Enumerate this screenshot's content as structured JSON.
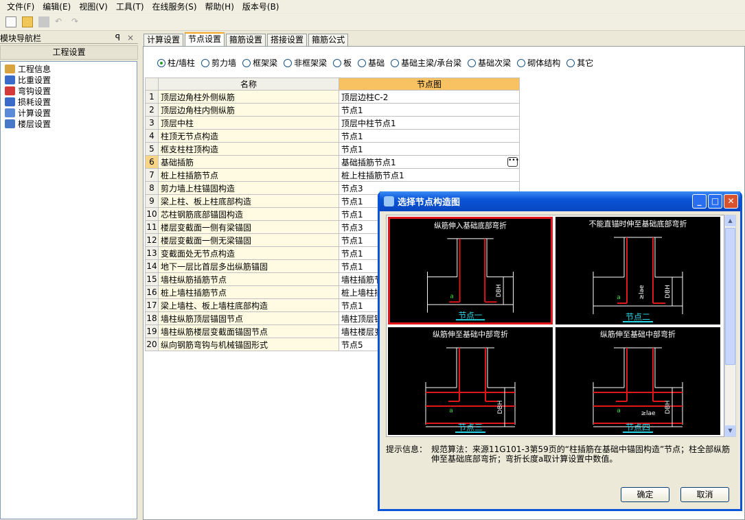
{
  "menu": [
    "文件(F)",
    "编辑(E)",
    "视图(V)",
    "工具(T)",
    "在线服务(S)",
    "帮助(H)",
    "版本号(B)"
  ],
  "toolbar": {
    "icons": [
      "new-file-icon",
      "open-folder-icon",
      "save-icon",
      "undo-icon",
      "redo-icon"
    ]
  },
  "nav": {
    "title": "模块导航栏",
    "pin": "ꟼ",
    "close": "×",
    "group": "工程设置",
    "items": [
      {
        "label": "工程信息",
        "color": "#d9a440"
      },
      {
        "label": "比重设置",
        "color": "#3a6bc9"
      },
      {
        "label": "弯钩设置",
        "color": "#d43a3a"
      },
      {
        "label": "损耗设置",
        "color": "#3a6bc9"
      },
      {
        "label": "计算设置",
        "color": "#5a8ad8"
      },
      {
        "label": "楼层设置",
        "color": "#4a78c8"
      }
    ]
  },
  "tabs": [
    "计算设置",
    "节点设置",
    "箍筋设置",
    "搭接设置",
    "箍筋公式"
  ],
  "active_tab": 1,
  "radios": [
    "柱/墙柱",
    "剪力墙",
    "框架梁",
    "非框架梁",
    "板",
    "基础",
    "基础主梁/承台梁",
    "基础次梁",
    "砌体结构",
    "其它"
  ],
  "selected_radio": 0,
  "grid": {
    "headers": [
      "名称",
      "节点图"
    ],
    "selected_row": 6,
    "rows": [
      [
        "1",
        "顶层边角柱外侧纵筋",
        "顶层边柱C-2"
      ],
      [
        "2",
        "顶层边角柱内侧纵筋",
        "节点1"
      ],
      [
        "3",
        "顶层中柱",
        "顶层中柱节点1"
      ],
      [
        "4",
        "柱顶无节点构造",
        "节点1"
      ],
      [
        "5",
        "框支柱柱顶构造",
        "节点1"
      ],
      [
        "6",
        "基础插筋",
        "基础插筋节点1"
      ],
      [
        "7",
        "桩上柱插筋节点",
        "桩上柱插筋节点1"
      ],
      [
        "8",
        "剪力墙上柱锚固构造",
        "节点3"
      ],
      [
        "9",
        "梁上柱、板上柱底部构造",
        "节点1"
      ],
      [
        "10",
        "芯柱钢筋底部锚固构造",
        "节点1"
      ],
      [
        "11",
        "楼层变截面一侧有梁锚固",
        "节点3"
      ],
      [
        "12",
        "楼层变截面一侧无梁锚固",
        "节点1"
      ],
      [
        "13",
        "变截面处无节点构造",
        "节点1"
      ],
      [
        "14",
        "地下一层比首层多出纵筋锚固",
        "节点1"
      ],
      [
        "15",
        "墙柱纵筋插筋节点",
        "墙柱插筋节"
      ],
      [
        "16",
        "桩上墙柱插筋节点",
        "桩上墙柱插"
      ],
      [
        "17",
        "梁上墙柱、板上墙柱底部构造",
        "节点1"
      ],
      [
        "18",
        "墙柱纵筋顶层锚固节点",
        "墙柱顶层锚"
      ],
      [
        "19",
        "墙柱纵筋楼层变截面锚固节点",
        "墙柱楼层变"
      ],
      [
        "20",
        "纵向钢筋弯钩与机械锚固形式",
        "节点5"
      ]
    ]
  },
  "dialog": {
    "title": "选择节点构造图",
    "min": "_",
    "max": "□",
    "close": "✕",
    "options": [
      {
        "title": "纵筋伸入基础底部弯折",
        "label": "节点一",
        "dim": "DBH",
        "a": "a"
      },
      {
        "title": "不能直锚时伸至基础底部弯折",
        "label": "节点二",
        "dim": "DBH",
        "a": "a",
        "lae": "≥lae"
      },
      {
        "title": "纵筋伸至基础中部弯折",
        "label": "节点三",
        "dim": "DBH",
        "a": "a"
      },
      {
        "title": "纵筋伸至基础中部弯折",
        "label": "节点四",
        "dim": "DBH",
        "a": "a",
        "lae": "≥lae"
      }
    ],
    "selected": 0,
    "tip_label": "提示信息：",
    "tip_text": "规范算法：来源11G101-3第59页的“柱插筋在基础中锚固构造”节点；柱全部纵筋伸至基础底部弯折；弯折长度a取计算设置中数值。",
    "ok": "确定",
    "cancel": "取消"
  },
  "colors": {
    "rebar": "#e0161b",
    "label": "#29d6e8",
    "selection": "#e0161b",
    "title_bar": "#0a52d6"
  }
}
